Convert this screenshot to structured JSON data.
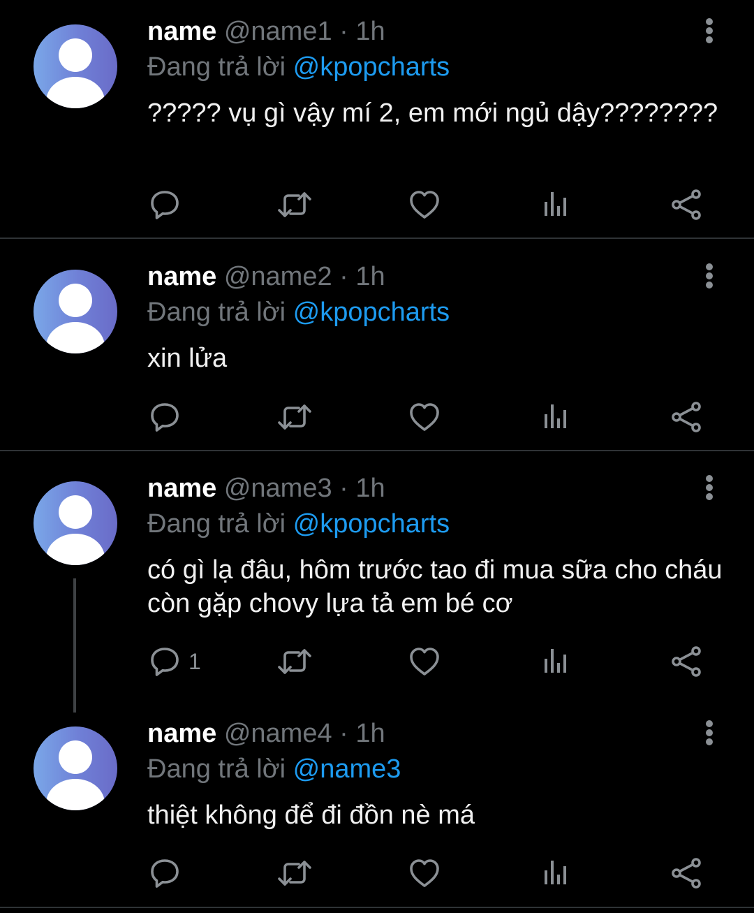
{
  "tweets": [
    {
      "name": "name",
      "handle": "@name1",
      "separator": "·",
      "time": "1h",
      "reply_prefix": "Đang trả lời",
      "reply_to": "@kpopcharts",
      "text": "????? vụ gì vậy mí 2, em mới ngủ dậy????????",
      "reply_count": ""
    },
    {
      "name": "name",
      "handle": "@name2",
      "separator": "·",
      "time": "1h",
      "reply_prefix": "Đang trả lời",
      "reply_to": "@kpopcharts",
      "text": "xin lửa",
      "reply_count": ""
    },
    {
      "name": "name",
      "handle": "@name3",
      "separator": "·",
      "time": "1h",
      "reply_prefix": "Đang trả lời",
      "reply_to": "@kpopcharts",
      "text": "có gì lạ đâu, hôm trước tao đi mua sữa cho cháu còn gặp chovy lựa tả em bé cơ",
      "reply_count": "1"
    },
    {
      "name": "name",
      "handle": "@name4",
      "separator": "·",
      "time": "1h",
      "reply_prefix": "Đang trả lời",
      "reply_to": "@name3",
      "text": "thiệt không để đi đồn nè má",
      "reply_count": ""
    }
  ],
  "icons": {
    "reply": "reply-icon",
    "retweet": "retweet-icon",
    "like": "heart-icon",
    "views": "analytics-icon",
    "share": "share-icon",
    "more": "more-vertical-icon",
    "avatar": "default-avatar-icon"
  },
  "colors": {
    "background": "#000000",
    "primary_text": "#e7e9ea",
    "secondary_text": "#71767b",
    "mention": "#1d9bf0",
    "icon": "#8b9095",
    "divider": "#2f3336"
  }
}
